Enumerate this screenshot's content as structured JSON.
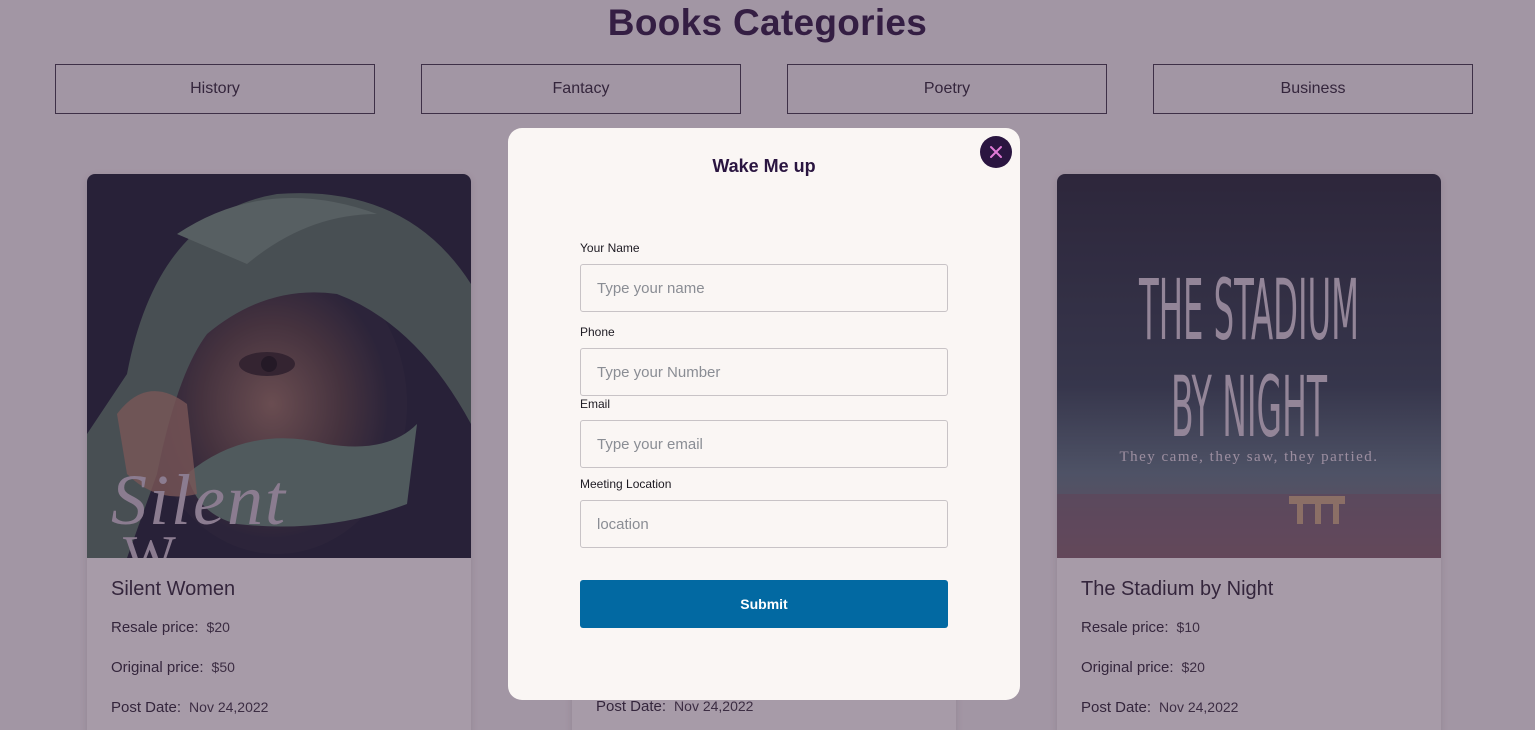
{
  "page": {
    "title": "Books Categories"
  },
  "categories": [
    "History",
    "Fantacy",
    "Poetry",
    "Business"
  ],
  "cards": [
    {
      "title": "Silent Women",
      "cover_text_1": "Silent",
      "cover_text_2": "W",
      "resale_label": "Resale price:",
      "resale_value": "$20",
      "original_label": "Original price:",
      "original_value": "$50",
      "date_label": "Post Date:",
      "date_value": "Nov 24,2022"
    },
    {
      "date_label": "Post Date:",
      "date_value": "Nov 24,2022"
    },
    {
      "title": "The Stadium by Night",
      "cover_text_1": "THE STADIUM",
      "cover_text_2": "BY NIGHT",
      "cover_tagline": "They came, they saw, they partied.",
      "resale_label": "Resale price:",
      "resale_value": "$10",
      "original_label": "Original price:",
      "original_value": "$20",
      "date_label": "Post Date:",
      "date_value": "Nov 24,2022"
    }
  ],
  "modal": {
    "title": "Wake Me up",
    "close_icon": "close-icon",
    "fields": [
      {
        "label": "Your Name",
        "placeholder": "Type your name"
      },
      {
        "label": "Phone",
        "placeholder": "Type your Number"
      },
      {
        "label": "Email",
        "placeholder": "Type your email"
      },
      {
        "label": "Meeting Location",
        "placeholder": "location"
      }
    ],
    "submit_label": "Submit"
  },
  "colors": {
    "accent": "#0269a2",
    "heading": "#2a1540",
    "close_x": "#e07bd6"
  }
}
